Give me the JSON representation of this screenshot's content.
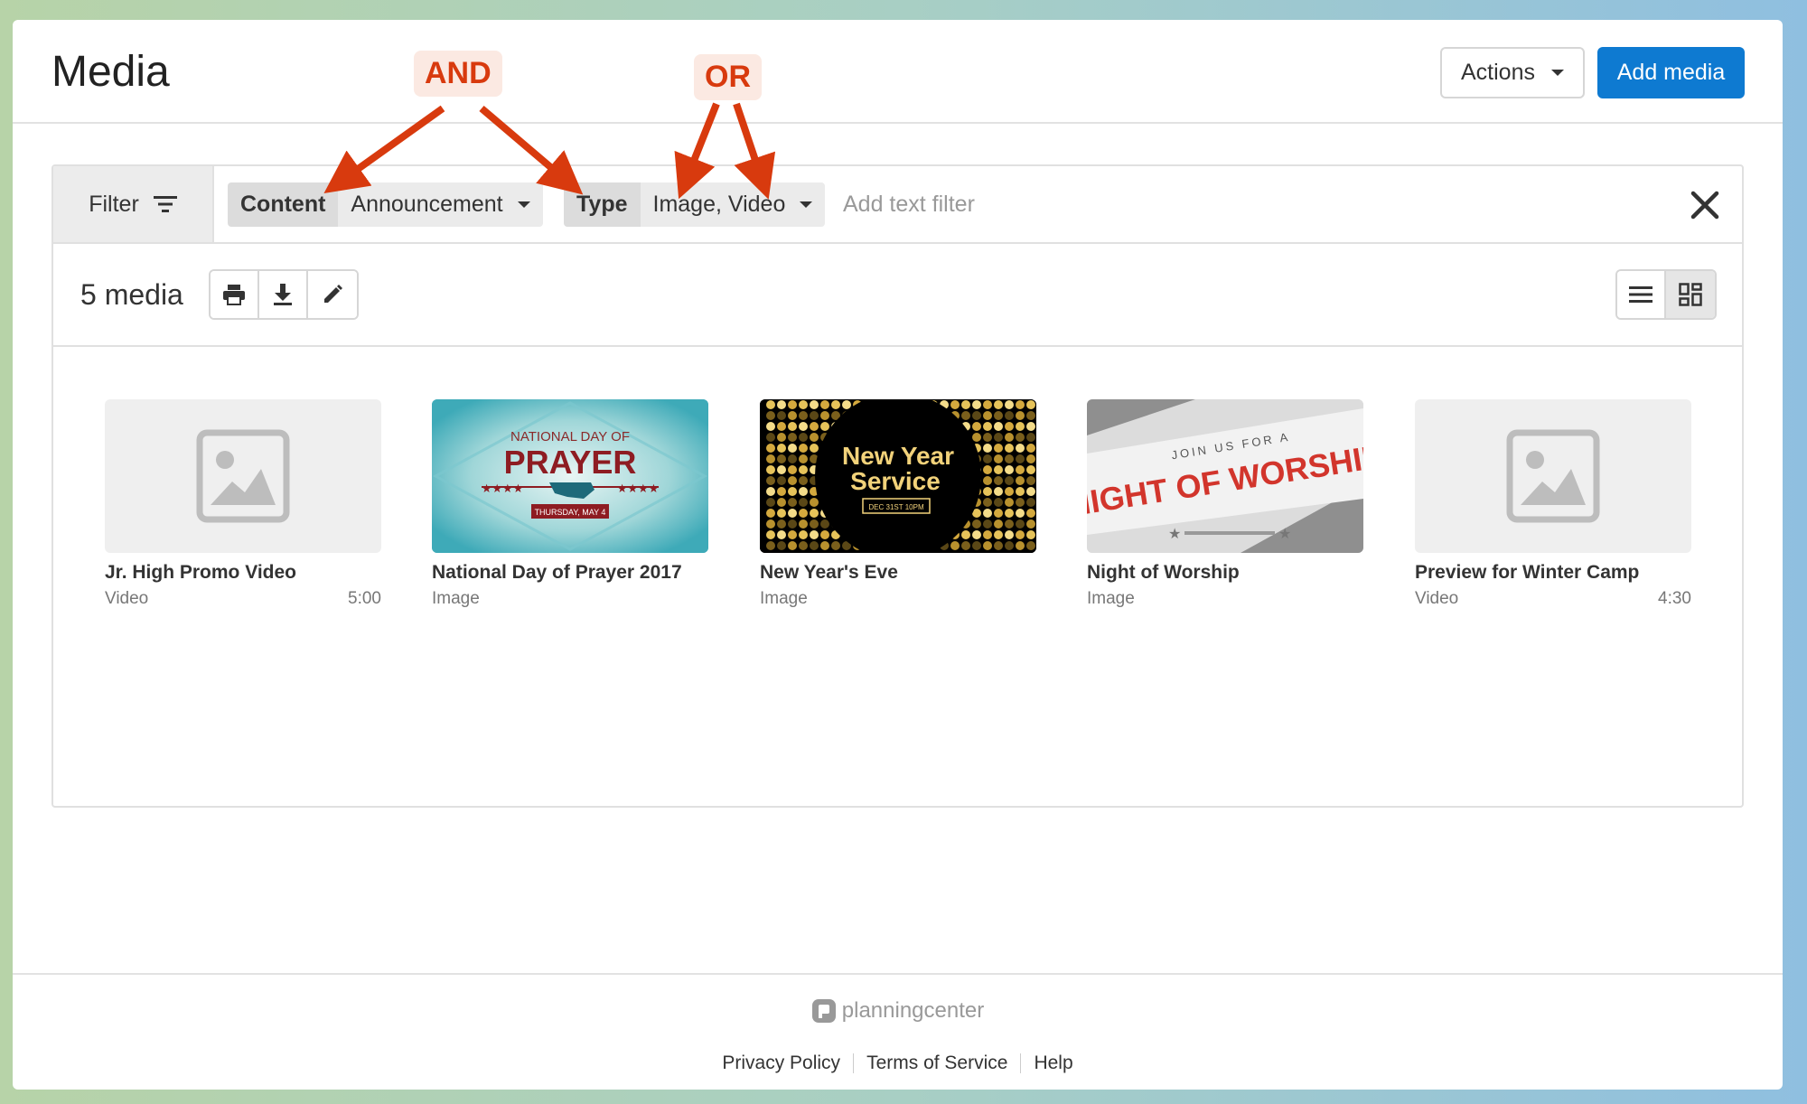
{
  "header": {
    "title": "Media",
    "actions_label": "Actions",
    "add_media_label": "Add media"
  },
  "annotations": {
    "and_label": "AND",
    "or_label": "OR"
  },
  "filter": {
    "label": "Filter",
    "chips": [
      {
        "key": "Content",
        "value": "Announcement"
      },
      {
        "key": "Type",
        "value": "Image, Video"
      }
    ],
    "text_placeholder": "Add text filter"
  },
  "toolbar": {
    "count": "5 media"
  },
  "media": [
    {
      "title": "Jr. High Promo Video",
      "type": "Video",
      "duration": "5:00",
      "thumb": "placeholder"
    },
    {
      "title": "National Day of Prayer 2017",
      "type": "Image",
      "duration": "",
      "thumb": "prayer",
      "art": {
        "line1": "NATIONAL DAY OF",
        "line2": "PRAYER",
        "line3": "THURSDAY, MAY 4"
      }
    },
    {
      "title": "New Year's Eve",
      "type": "Image",
      "duration": "",
      "thumb": "newyear",
      "art": {
        "line1": "New Year",
        "line2": "Service",
        "line3": "DEC 31ST 10PM"
      }
    },
    {
      "title": "Night of Worship",
      "type": "Image",
      "duration": "",
      "thumb": "worship",
      "art": {
        "line1": "JOIN US FOR A",
        "line2": "NIGHT OF WORSHIP"
      }
    },
    {
      "title": "Preview for Winter Camp",
      "type": "Video",
      "duration": "4:30",
      "thumb": "placeholder"
    }
  ],
  "footer": {
    "brand": "planningcenter",
    "links": [
      "Privacy Policy",
      "Terms of Service",
      "Help"
    ]
  },
  "colors": {
    "primary": "#0e7ad1",
    "annotation": "#d83a0e"
  }
}
